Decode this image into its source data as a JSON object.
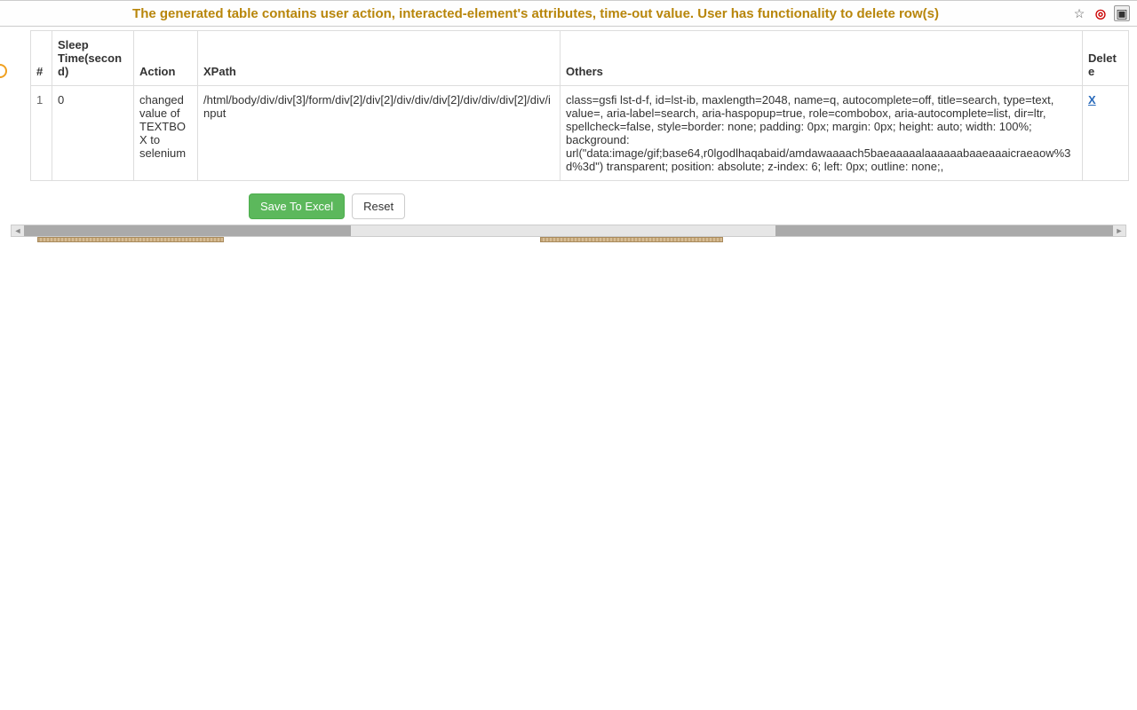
{
  "topbar": {
    "title": "The generated table contains user action, interacted-element's attributes, time-out value. User has functionality to delete row(s)"
  },
  "table": {
    "headers": {
      "num": "#",
      "sleep": "Sleep Time(second)",
      "action": "Action",
      "xpath": "XPath",
      "others": "Others",
      "delete": "Delete"
    },
    "rows": [
      {
        "num": "1",
        "sleep": "0",
        "action": "changed value of TEXTBOX to selenium",
        "xpath": "/html/body/div/div[3]/form/div[2]/div[2]/div/div/div[2]/div/div/div[2]/div/input",
        "others": "class=gsfi lst-d-f, id=lst-ib, maxlength=2048, name=q, autocomplete=off, title=search, type=text, value=, aria-label=search, aria-haspopup=true, role=combobox, aria-autocomplete=list, dir=ltr, spellcheck=false, style=border: none; padding: 0px; margin: 0px; height: auto; width: 100%; background: url(\"data:image/gif;base64,r0lgodlhaqabaid/amdawaaaach5baeaaaaalaaaaaabaaeaaaicraeaow%3d%3d\") transparent; position: absolute; z-index: 6; left: 0px; outline: none;,",
        "delete": "X"
      }
    ]
  },
  "buttons": {
    "save": "Save To Excel",
    "reset": "Reset"
  }
}
